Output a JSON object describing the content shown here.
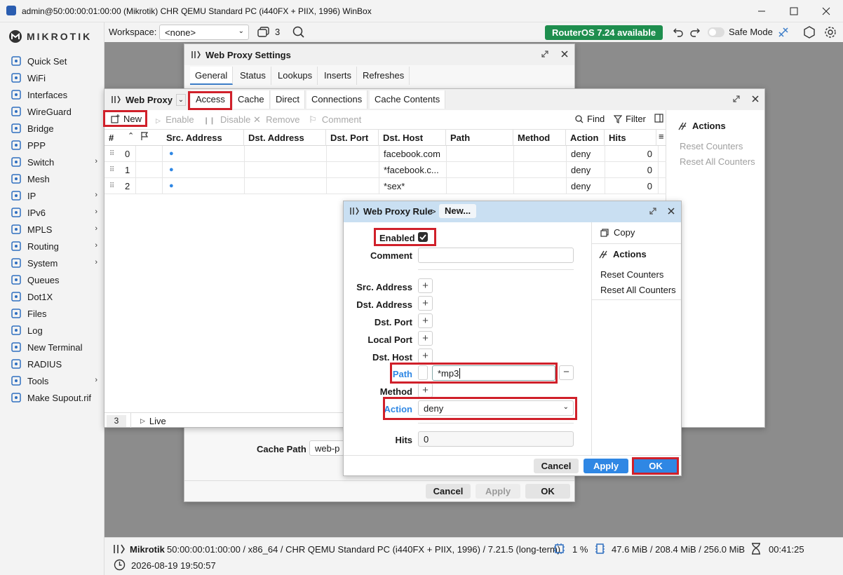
{
  "titlebar": {
    "title": "admin@50:00:00:01:00:00 (Mikrotik) CHR QEMU Standard PC (i440FX + PIIX, 1996) WinBox"
  },
  "sidebar": {
    "logo": "MIKROTIK",
    "items": [
      {
        "label": "Quick Set",
        "icon": "quickset-icon"
      },
      {
        "label": "WiFi",
        "icon": "wifi-icon"
      },
      {
        "label": "Interfaces",
        "icon": "interfaces-icon"
      },
      {
        "label": "WireGuard",
        "icon": "wireguard-icon"
      },
      {
        "label": "Bridge",
        "icon": "bridge-icon"
      },
      {
        "label": "PPP",
        "icon": "ppp-icon"
      },
      {
        "label": "Switch",
        "icon": "switch-icon",
        "sub": "›"
      },
      {
        "label": "Mesh",
        "icon": "mesh-icon"
      },
      {
        "label": "IP",
        "icon": "ip-icon",
        "sub": "›"
      },
      {
        "label": "IPv6",
        "icon": "ipv6-icon",
        "sub": "›"
      },
      {
        "label": "MPLS",
        "icon": "mpls-icon",
        "sub": "›"
      },
      {
        "label": "Routing",
        "icon": "routing-icon",
        "sub": "›"
      },
      {
        "label": "System",
        "icon": "system-icon",
        "sub": "›"
      },
      {
        "label": "Queues",
        "icon": "queues-icon"
      },
      {
        "label": "Dot1X",
        "icon": "dot1x-icon"
      },
      {
        "label": "Files",
        "icon": "files-icon"
      },
      {
        "label": "Log",
        "icon": "log-icon"
      },
      {
        "label": "New Terminal",
        "icon": "terminal-icon"
      },
      {
        "label": "RADIUS",
        "icon": "radius-icon"
      },
      {
        "label": "Tools",
        "icon": "tools-icon",
        "sub": "›"
      },
      {
        "label": "Make Supout.rif",
        "icon": "supout-icon"
      }
    ]
  },
  "topbar": {
    "workspace_label": "Workspace:",
    "workspace_value": "<none>",
    "window_count": "3",
    "update_badge": "RouterOS 7.24 available",
    "safe_mode": "Safe Mode"
  },
  "settings_window": {
    "title": "Web Proxy Settings",
    "tabs": [
      "General",
      "Status",
      "Lookups",
      "Inserts",
      "Refreshes"
    ],
    "cache_path_label": "Cache Path",
    "cache_path_value": "web-p",
    "cancel": "Cancel",
    "apply": "Apply",
    "ok": "OK"
  },
  "proxy_window": {
    "title": "Web Proxy",
    "tabs": [
      "Access",
      "Cache",
      "Direct",
      "Connections",
      "Cache Contents"
    ],
    "toolbar": {
      "new": "New",
      "enable": "Enable",
      "disable": "Disable",
      "remove": "Remove",
      "comment": "Comment",
      "find": "Find",
      "filter": "Filter"
    },
    "columns": [
      "#",
      "Src. Address",
      "Dst. Address",
      "Dst. Port",
      "Dst. Host",
      "Path",
      "Method",
      "Action",
      "Hits"
    ],
    "rows": [
      {
        "num": "0",
        "dst_host": "facebook.com",
        "action": "deny",
        "hits": "0"
      },
      {
        "num": "1",
        "dst_host": "*facebook.c...",
        "action": "deny",
        "hits": "0"
      },
      {
        "num": "2",
        "dst_host": "*sex*",
        "action": "deny",
        "hits": "0"
      }
    ],
    "footer_count": "3",
    "footer_live": "Live",
    "actions": {
      "title": "Actions",
      "reset": "Reset Counters",
      "reset_all": "Reset All Counters"
    }
  },
  "rule_dialog": {
    "title": "Web Proxy Rule",
    "crumb": "New...",
    "enabled_label": "Enabled",
    "comment_label": "Comment",
    "fields": [
      "Src. Address",
      "Dst. Address",
      "Dst. Port",
      "Local Port",
      "Dst. Host"
    ],
    "path_label": "Path",
    "path_value": "*mp3",
    "method_label": "Method",
    "action_label": "Action",
    "action_value": "deny",
    "hits_label": "Hits",
    "hits_value": "0",
    "side": {
      "copy": "Copy",
      "actions": "Actions",
      "reset": "Reset Counters",
      "reset_all": "Reset All Counters"
    },
    "cancel": "Cancel",
    "apply": "Apply",
    "ok": "OK"
  },
  "statusbar": {
    "device": "Mikrotik",
    "info": "50:00:00:01:00:00 / x86_64 / CHR QEMU Standard PC (i440FX + PIIX, 1996) / 7.21.5 (long-term)",
    "cpu": "1 %",
    "memory": "47.6 MiB / 208.4 MiB / 256.0 MiB",
    "uptime": "00:41:25",
    "datetime": "2026-08-19 19:50:57"
  },
  "colors": {
    "accent": "#2f87e4",
    "highlight": "#d0202a",
    "badge": "#1e8e4e",
    "dialog_header": "#c9dff2"
  }
}
